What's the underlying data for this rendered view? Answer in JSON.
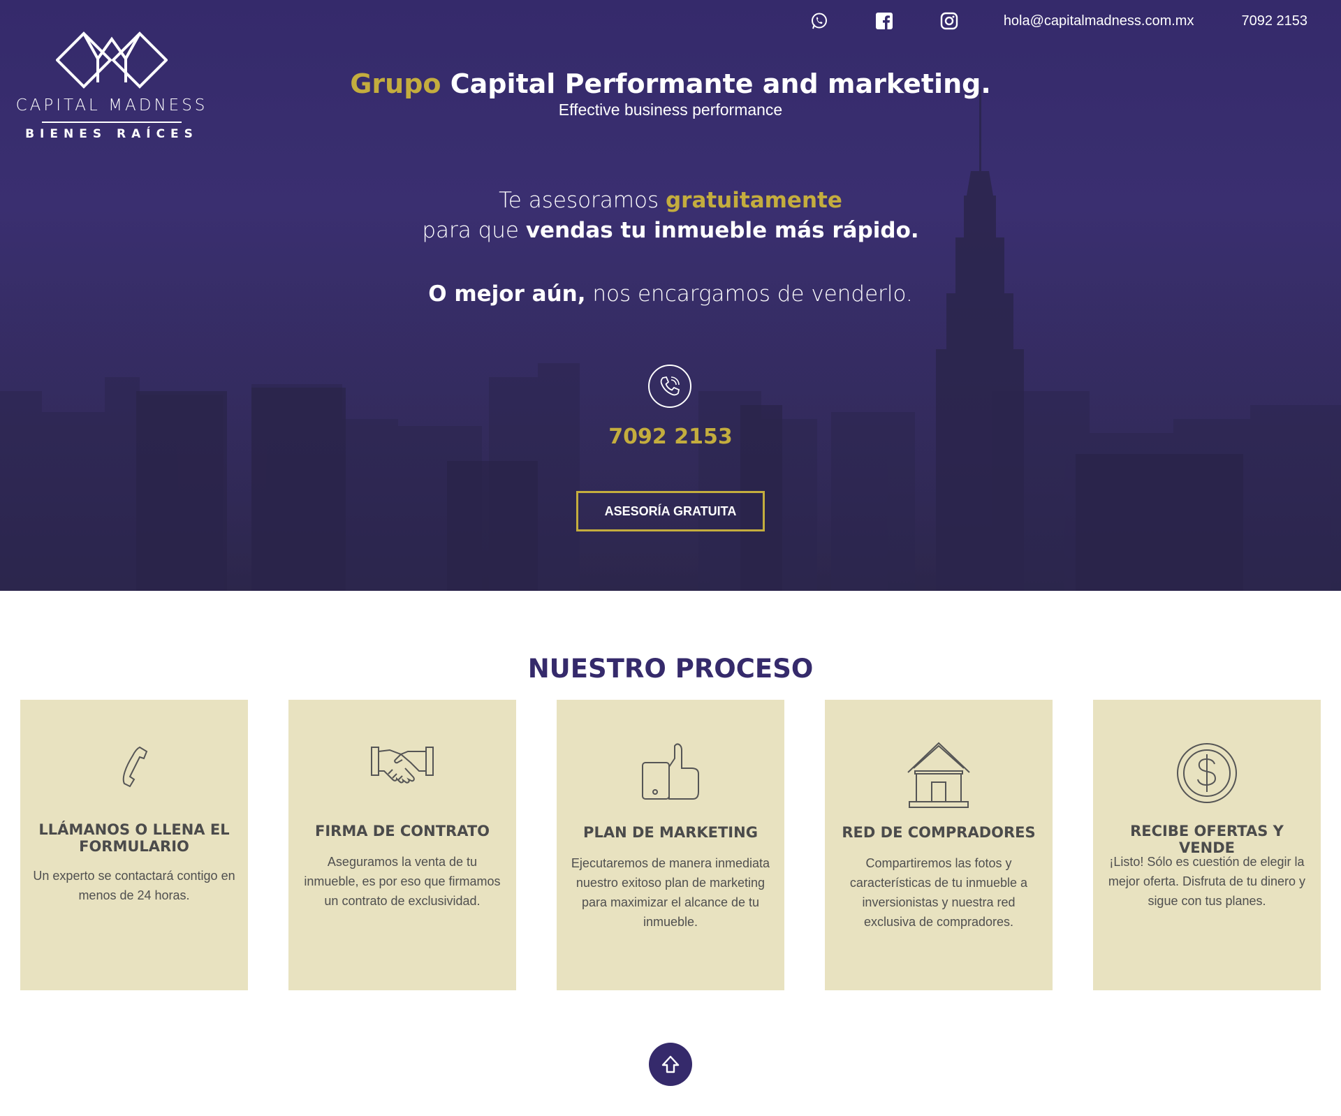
{
  "brand": {
    "logo_name": "CAPITAL MADNESS",
    "logo_sub": "BIENES RAÍCES"
  },
  "topbar": {
    "icons": [
      "whatsapp-icon",
      "facebook-icon",
      "instagram-icon"
    ],
    "email": "hola@capitalmadness.com.mx",
    "phone": "7092 2153"
  },
  "hero": {
    "headline_gold": "Grupo",
    "headline_rest": " Capital Performante and marketing.",
    "subheadline": "Effective business performance",
    "line1_plain": "Te asesoramos ",
    "line1_gold": "gratuitamente",
    "line2_plain": "para que ",
    "line2_bold": "vendas tu inmueble más rápido.",
    "line3_bold": "O mejor aún,",
    "line3_plain": " nos encargamos de venderlo.",
    "phone": "7092 2153",
    "cta_label": "ASESORÍA GRATUITA"
  },
  "process": {
    "title": "NUESTRO PROCESO",
    "steps": [
      {
        "icon": "phone-handset-icon",
        "title": "LLÁMANOS O LLENA EL FORMULARIO",
        "desc": "Un experto se contactará contigo en menos de 24 horas."
      },
      {
        "icon": "handshake-icon",
        "title": "FIRMA DE CONTRATO",
        "desc": "Aseguramos la venta de tu inmueble, es por eso que firmamos un contrato de exclusividad."
      },
      {
        "icon": "thumbs-up-icon",
        "title": "PLAN DE MARKETING",
        "desc": "Ejecutaremos de manera inmediata nuestro exitoso plan de marketing para maximizar el alcance de tu inmueble."
      },
      {
        "icon": "house-icon",
        "title": "RED DE COMPRADORES",
        "desc": "Compartiremos las fotos y características de tu inmueble a inversionistas y nuestra red exclusiva de compradores."
      },
      {
        "icon": "dollar-coin-icon",
        "title": "RECIBE OFERTAS Y VENDE",
        "desc": "¡Listo! Sólo es cuestión de elegir la mejor oferta. Disfruta de tu dinero y sigue con tus planes."
      }
    ]
  },
  "colors": {
    "hero_purple": "#352a6b",
    "gold": "#c4ad3e",
    "card_beige": "#e8e2c0"
  }
}
